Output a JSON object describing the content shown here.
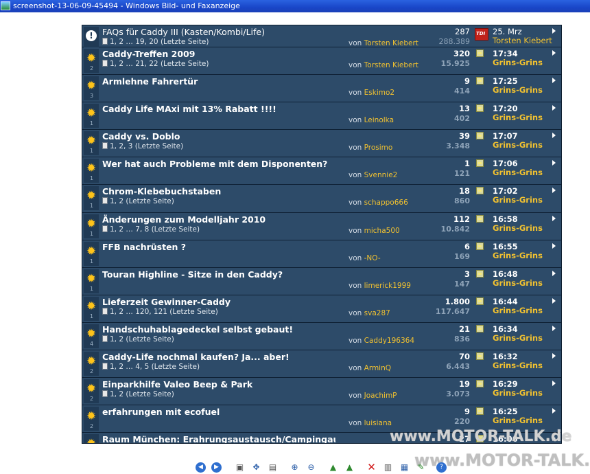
{
  "window": {
    "title": "screenshot-13-06-09-45494 - Windows Bild- und Faxanzeige"
  },
  "forum": {
    "by_prefix": "von",
    "topics": [
      {
        "type": "sticky",
        "title": "FAQs für Caddy III (Kasten/Kombi/Life)",
        "pages": "1, 2 … 19, 20 (Letzte Seite)",
        "author": "Torsten Kiebert",
        "replies": "287",
        "views": "288.389",
        "last_time": "25. Mrz",
        "last_user": "Torsten Kiebert",
        "num": ""
      },
      {
        "type": "hot",
        "title": "Caddy-Treffen 2009",
        "pages": "1, 2 … 21, 22 (Letzte Seite)",
        "author": "Torsten Kiebert",
        "replies": "320",
        "views": "15.925",
        "last_time": "17:34",
        "last_user": "Grins-Grins",
        "num": "2"
      },
      {
        "type": "normal",
        "title": "Armlehne Fahrertür",
        "pages": "",
        "author": "Eskimo2",
        "replies": "9",
        "views": "414",
        "last_time": "17:25",
        "last_user": "Grins-Grins",
        "num": "3"
      },
      {
        "type": "normal",
        "title": "Caddy Life MAxi mit 13% Rabatt !!!!",
        "pages": "",
        "author": "Leinolka",
        "replies": "13",
        "views": "402",
        "last_time": "17:20",
        "last_user": "Grins-Grins",
        "num": "1"
      },
      {
        "type": "normal",
        "title": "Caddy vs. Doblo",
        "pages": "1, 2, 3 (Letzte Seite)",
        "author": "Prosimo",
        "replies": "39",
        "views": "3.348",
        "last_time": "17:07",
        "last_user": "Grins-Grins",
        "num": "1"
      },
      {
        "type": "normal",
        "title": "Wer hat auch Probleme mit dem Disponenten?",
        "pages": "",
        "author": "Svennie2",
        "replies": "1",
        "views": "121",
        "last_time": "17:06",
        "last_user": "Grins-Grins",
        "num": "1"
      },
      {
        "type": "hot",
        "title": "Chrom-Klebebuchstaben",
        "pages": "1, 2 (Letzte Seite)",
        "author": "schappo666",
        "replies": "18",
        "views": "860",
        "last_time": "17:02",
        "last_user": "Grins-Grins",
        "num": "1"
      },
      {
        "type": "normal",
        "title": "Änderungen zum Modelljahr 2010",
        "pages": "1, 2 … 7, 8 (Letzte Seite)",
        "author": "micha500",
        "replies": "112",
        "views": "10.842",
        "last_time": "16:58",
        "last_user": "Grins-Grins",
        "num": "1"
      },
      {
        "type": "normal",
        "title": "FFB nachrüsten ?",
        "pages": "",
        "author": "-NO-",
        "replies": "6",
        "views": "169",
        "last_time": "16:55",
        "last_user": "Grins-Grins",
        "num": "1"
      },
      {
        "type": "normal",
        "title": "Touran Highline - Sitze in den Caddy?",
        "pages": "",
        "author": "limerick1999",
        "replies": "3",
        "views": "147",
        "last_time": "16:48",
        "last_user": "Grins-Grins",
        "num": "1"
      },
      {
        "type": "hot",
        "title": "Lieferzeit Gewinner-Caddy",
        "pages": "1, 2 … 120, 121 (Letzte Seite)",
        "author": "sva287",
        "replies": "1.800",
        "views": "117.647",
        "last_time": "16:44",
        "last_user": "Grins-Grins",
        "num": "1"
      },
      {
        "type": "hot",
        "title": "Handschuhablagedeckel selbst gebaut!",
        "pages": "1, 2 (Letzte Seite)",
        "author": "Caddy196364",
        "replies": "21",
        "views": "836",
        "last_time": "16:34",
        "last_user": "Grins-Grins",
        "num": "4"
      },
      {
        "type": "normal",
        "title": "Caddy-Life nochmal kaufen? Ja... aber!",
        "pages": "1, 2 … 4, 5 (Letzte Seite)",
        "author": "ArminQ",
        "replies": "70",
        "views": "6.443",
        "last_time": "16:32",
        "last_user": "Grins-Grins",
        "num": "2"
      },
      {
        "type": "normal",
        "title": "Einparkhilfe Valeo Beep & Park",
        "pages": "1, 2 (Letzte Seite)",
        "author": "JoachimP",
        "replies": "19",
        "views": "3.073",
        "last_time": "16:29",
        "last_user": "Grins-Grins",
        "num": "2"
      },
      {
        "type": "normal",
        "title": "erfahrungen mit ecofuel",
        "pages": "",
        "author": "luisiana",
        "replies": "9",
        "views": "220",
        "last_time": "16:25",
        "last_user": "Grins-Grins",
        "num": "2"
      },
      {
        "type": "normal",
        "title": "Raum München: Erahrungsaustausch/Campingausbau gesucht",
        "pages": "",
        "author": "",
        "replies": "27",
        "views": "",
        "last_time": "16:06",
        "last_user": "",
        "num": ""
      }
    ]
  },
  "watermark": {
    "text_1": "www.MOTOR-TALK.de",
    "text_2": "www.MOTOR-TALK.de"
  },
  "toolbar": {
    "icons": [
      "prev-image-icon",
      "next-image-icon",
      "best-fit-icon",
      "actual-size-icon",
      "slideshow-icon",
      "zoom-in-icon",
      "zoom-out-icon",
      "rotate-clockwise-icon",
      "rotate-counterclockwise-icon",
      "delete-icon",
      "print-icon",
      "save-icon",
      "edit-icon",
      "help-icon"
    ]
  }
}
